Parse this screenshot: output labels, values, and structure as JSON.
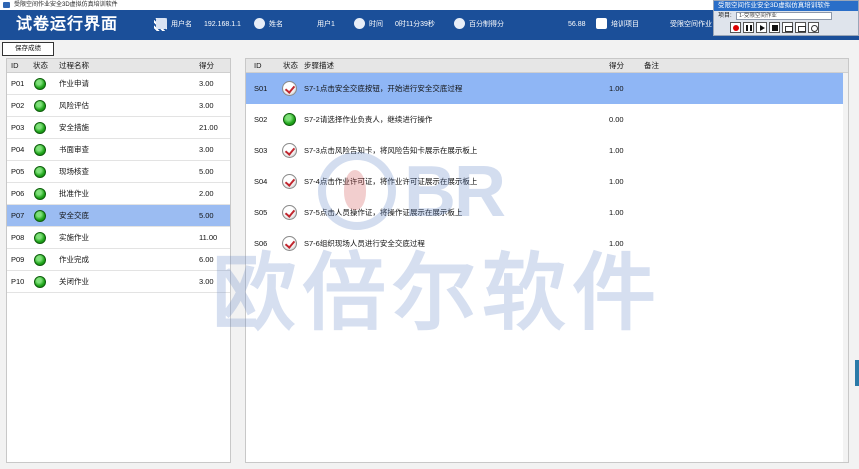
{
  "window": {
    "title": "受限空间作业安全3D虚拟仿真培训软件"
  },
  "header": {
    "page_title": "试卷运行界面",
    "username_label": "用户名",
    "username_value": "192.168.1.1",
    "name_label": "姓名",
    "user_value": "用户1",
    "time_label": "时间",
    "time_value": "0时11分39秒",
    "score_mode_label": "百分制得分",
    "score_value": "56.88",
    "training_item_label": "培训项目",
    "training_item_value": "受限空间作业"
  },
  "control_panel": {
    "title": "受限空间作业安全3D虚拟仿真培训软件",
    "project_label": "项目:",
    "project_value": "1-受限空间作业"
  },
  "toolbar": {
    "save_label": "保存成绩"
  },
  "process_table": {
    "headers": [
      "ID",
      "状态",
      "过程名称",
      "得分"
    ],
    "rows": [
      {
        "id": "P01",
        "name": "作业申请",
        "score": "3.00"
      },
      {
        "id": "P02",
        "name": "风险评估",
        "score": "3.00"
      },
      {
        "id": "P03",
        "name": "安全措施",
        "score": "21.00"
      },
      {
        "id": "P04",
        "name": "书面审查",
        "score": "3.00"
      },
      {
        "id": "P05",
        "name": "现场核查",
        "score": "5.00"
      },
      {
        "id": "P06",
        "name": "批准作业",
        "score": "2.00"
      },
      {
        "id": "P07",
        "name": "安全交底",
        "score": "5.00"
      },
      {
        "id": "P08",
        "name": "实施作业",
        "score": "11.00"
      },
      {
        "id": "P09",
        "name": "作业完成",
        "score": "6.00"
      },
      {
        "id": "P10",
        "name": "关闭作业",
        "score": "3.00"
      }
    ]
  },
  "step_table": {
    "headers": [
      "ID",
      "状态",
      "步骤描述",
      "得分",
      "备注"
    ],
    "rows": [
      {
        "id": "S01",
        "status": "checked",
        "desc": "S7-1点击安全交底按钮，开始进行安全交底过程",
        "score": "1.00",
        "remark": ""
      },
      {
        "id": "S02",
        "status": "green",
        "desc": "S7-2请选择作业负责人，继续进行操作",
        "score": "0.00",
        "remark": ""
      },
      {
        "id": "S03",
        "status": "checked",
        "desc": "S7-3点击风险告知卡，将风险告知卡展示在展示板上",
        "score": "1.00",
        "remark": ""
      },
      {
        "id": "S04",
        "status": "checked",
        "desc": "S7-4点击作业许可证，将作业许可证展示在展示板上",
        "score": "1.00",
        "remark": ""
      },
      {
        "id": "S05",
        "status": "checked",
        "desc": "S7-5点击人员操作证，将操作证展示在展示板上",
        "score": "1.00",
        "remark": ""
      },
      {
        "id": "S06",
        "status": "checked",
        "desc": "S7-6组织现场人员进行安全交底过程",
        "score": "1.00",
        "remark": ""
      }
    ]
  },
  "watermark": {
    "logo": "BR",
    "text": "欧倍尔软件"
  }
}
